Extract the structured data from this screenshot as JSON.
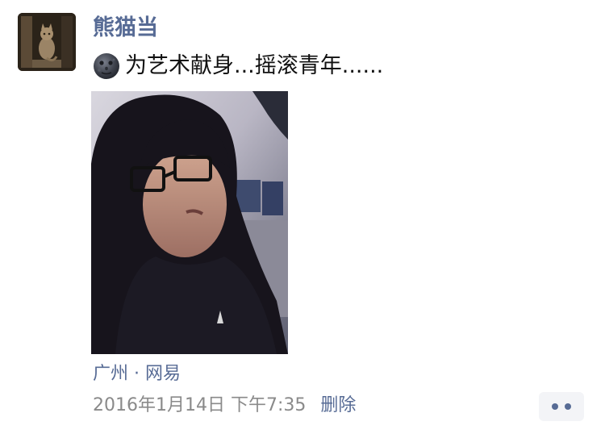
{
  "post": {
    "author": "熊猫当",
    "emoji_icon": "new-moon-face-icon",
    "text": "为艺术献身...摇滚青年......",
    "location": "广州 · 网易",
    "timestamp": "2016年1月14日 下午7:35",
    "delete_label": "删除",
    "more_icon": "more-dots-icon"
  },
  "colors": {
    "link": "#576b95",
    "meta_gray": "#8a8a8a",
    "text": "#111111",
    "more_button_bg": "#f3f4f7"
  }
}
